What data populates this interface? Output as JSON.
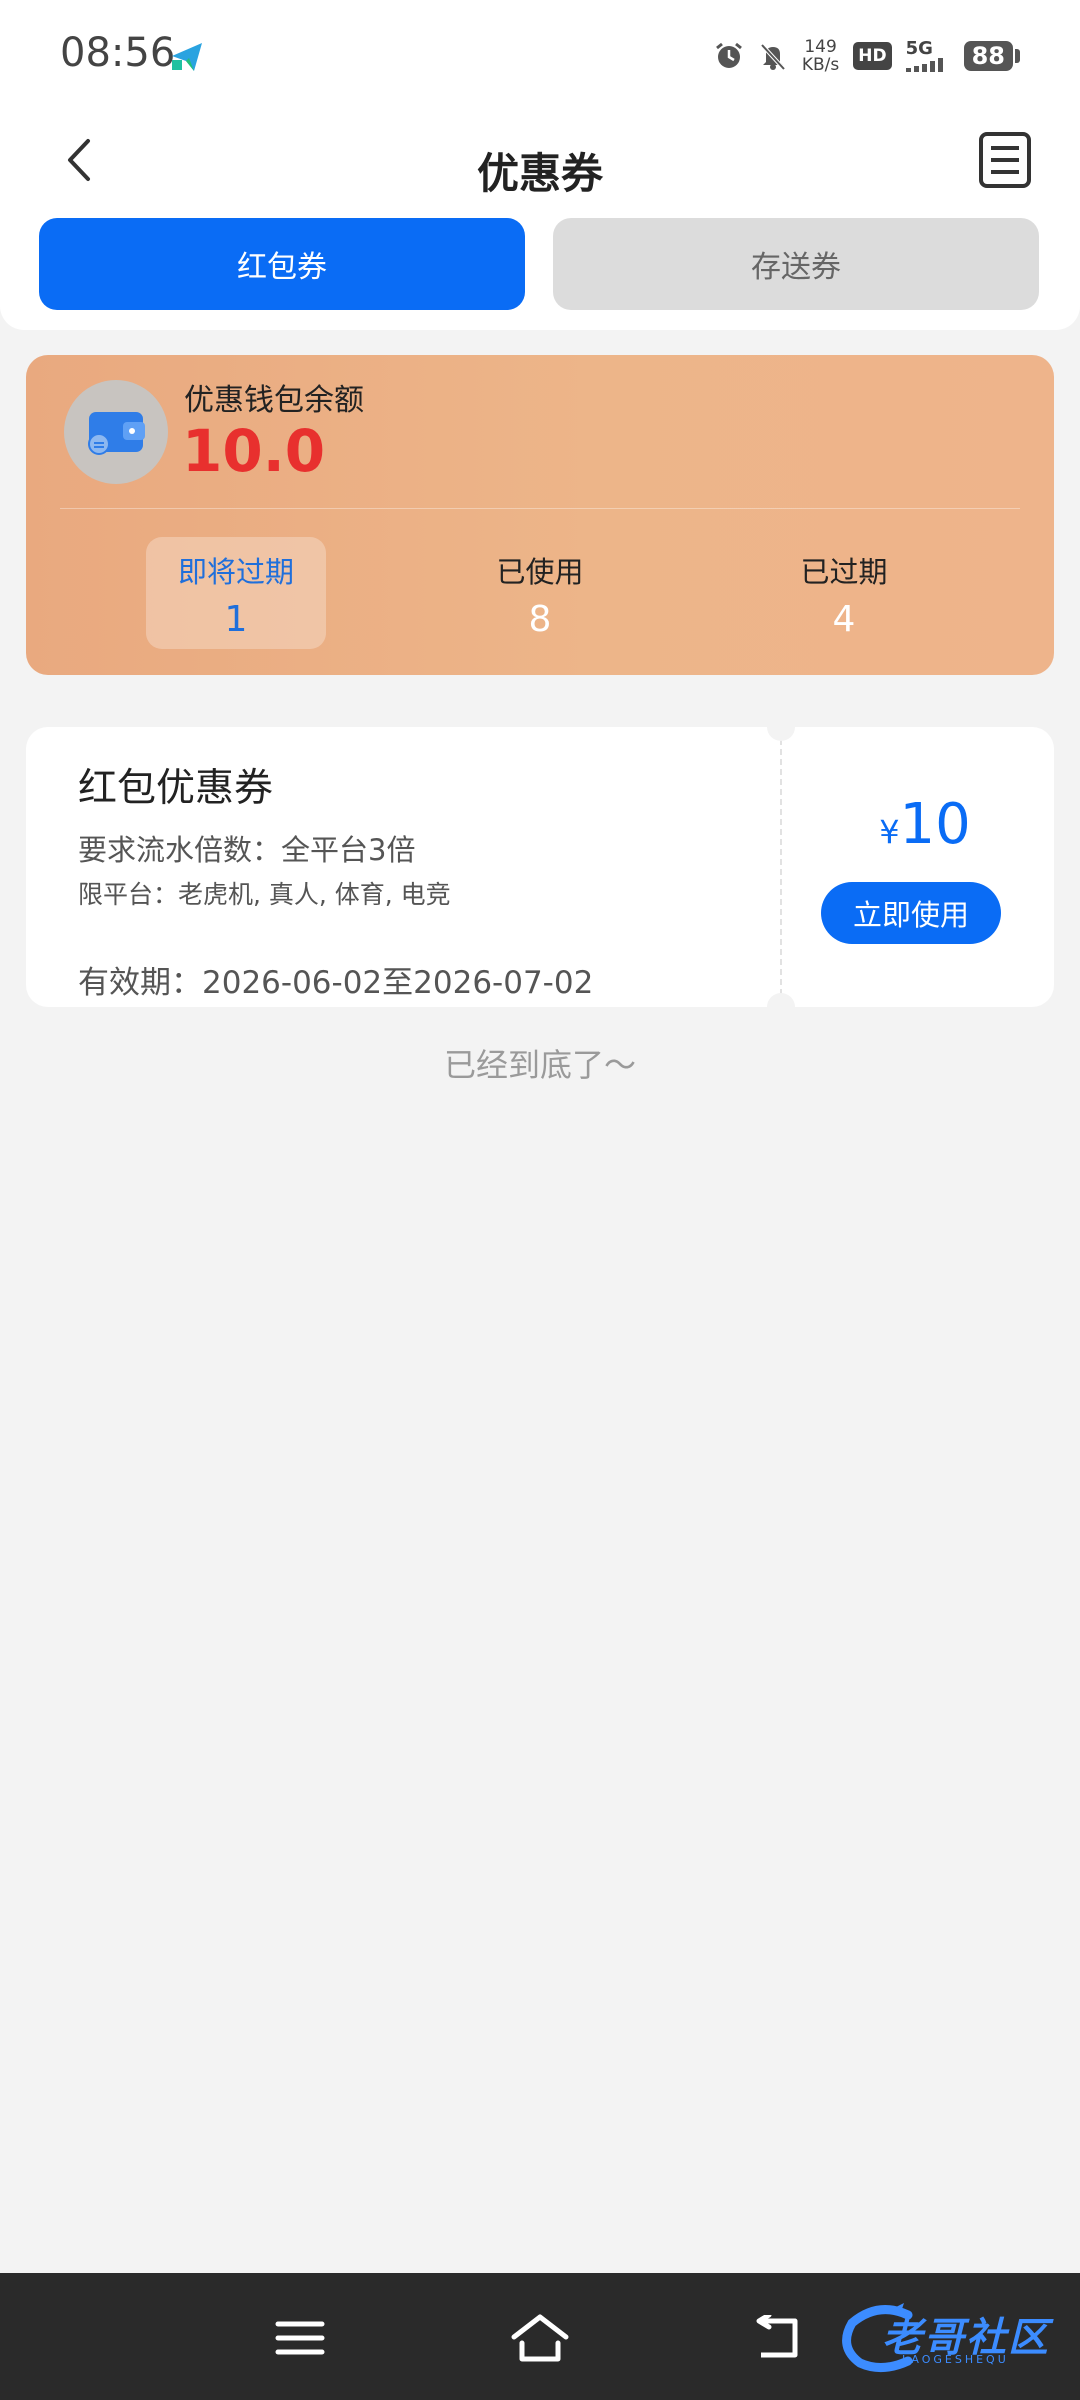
{
  "status_bar": {
    "time": "08:56",
    "speed_value": "149",
    "speed_unit": "KB/s",
    "hd": "HD",
    "network": "5G",
    "battery": "88"
  },
  "header": {
    "title": "优惠券"
  },
  "tabs": [
    {
      "label": "红包券",
      "active": true
    },
    {
      "label": "存送券",
      "active": false
    }
  ],
  "wallet": {
    "label": "优惠钱包余额",
    "balance": "10.0",
    "stats": [
      {
        "label": "即将过期",
        "value": "1",
        "active": true
      },
      {
        "label": "已使用",
        "value": "8",
        "active": false
      },
      {
        "label": "已过期",
        "value": "4",
        "active": false
      }
    ]
  },
  "coupon": {
    "title": "红包优惠券",
    "flow_requirement": "要求流水倍数：全平台3倍",
    "platforms": "限平台：老虎机, 真人, 体育, 电竞",
    "validity": "有效期：2026-06-02至2026-07-02",
    "currency": "¥",
    "amount": "10",
    "use_button": "立即使用"
  },
  "end_text": "已经到底了～",
  "watermark": {
    "text": "老哥社区",
    "sub": "LAOGESHEQU"
  },
  "colors": {
    "accent": "#0a6cf5",
    "balance_red": "#e8302e",
    "wallet_card": "#edb589"
  }
}
